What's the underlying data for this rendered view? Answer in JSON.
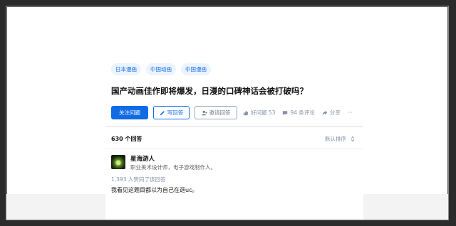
{
  "question": {
    "topics": [
      "日本漫画",
      "中国动画",
      "中国漫画"
    ],
    "title": "国产动画佳作即将爆发，日漫的口碑神话会被打破吗？",
    "actions": {
      "follow": "关注问题",
      "write_answer": "写回答",
      "invite": "邀请回答",
      "likes": "好问题 53",
      "comments": "94 条评论",
      "share": "分享",
      "more": "···"
    }
  },
  "answers": {
    "count": "630 个回答",
    "sort": "默认排序"
  },
  "answer": {
    "author_name": "星海游人",
    "author_bio": "职业美术设计师，电子游戏制作人。",
    "agree": "1,393 人赞同了该回答",
    "text": "我看见这题目都以为自己在逛uc。"
  },
  "colors": {
    "accent": "#0f6be6",
    "topic_bg": "#ebf3ff",
    "muted": "#8590a6"
  }
}
